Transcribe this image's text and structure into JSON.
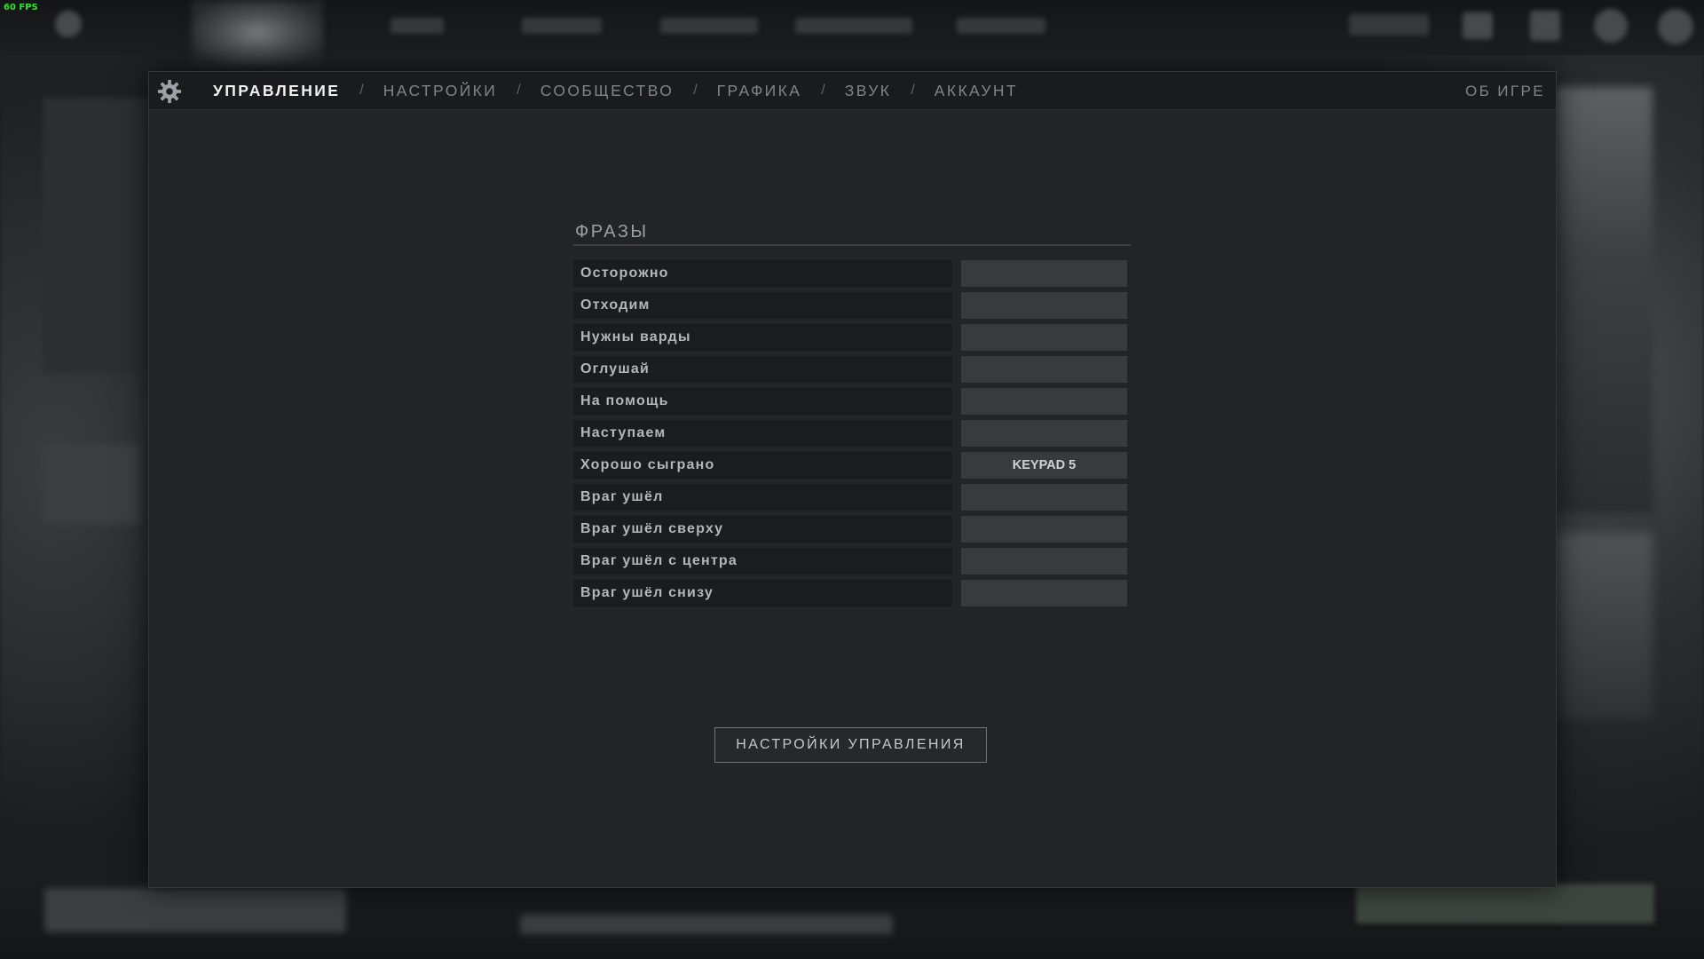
{
  "overlay": {
    "fps": "60 FPS"
  },
  "tabs": [
    {
      "label": "УПРАВЛЕНИЕ",
      "active": true
    },
    {
      "label": "НАСТРОЙКИ",
      "active": false
    },
    {
      "label": "СООБЩЕСТВО",
      "active": false
    },
    {
      "label": "ГРАФИКА",
      "active": false
    },
    {
      "label": "ЗВУК",
      "active": false
    },
    {
      "label": "АККАУНТ",
      "active": false
    }
  ],
  "tab_separator": "/",
  "about": "ОБ ИГРЕ",
  "section": {
    "title": "ФРАЗЫ",
    "rows": [
      {
        "label": "Осторожно",
        "key": ""
      },
      {
        "label": "Отходим",
        "key": ""
      },
      {
        "label": "Нужны варды",
        "key": ""
      },
      {
        "label": "Оглушай",
        "key": ""
      },
      {
        "label": "На помощь",
        "key": ""
      },
      {
        "label": "Наступаем",
        "key": ""
      },
      {
        "label": "Хорошо сыграно",
        "key": "KEYPAD 5"
      },
      {
        "label": "Враг ушёл",
        "key": ""
      },
      {
        "label": "Враг ушёл сверху",
        "key": ""
      },
      {
        "label": "Враг ушёл с центра",
        "key": ""
      },
      {
        "label": "Враг ушёл снизу",
        "key": ""
      }
    ]
  },
  "controls_button": "НАСТРОЙКИ УПРАВЛЕНИЯ",
  "colors": {
    "dialog_bg": "#222427",
    "tabbar_bg": "#1a1b1d",
    "active_tab": "#f2f2f2",
    "inactive_tab": "#7f858a",
    "key_cell": "#383b3e",
    "fps": "#2ee52e"
  },
  "icons": {
    "settings": "gear-icon"
  }
}
